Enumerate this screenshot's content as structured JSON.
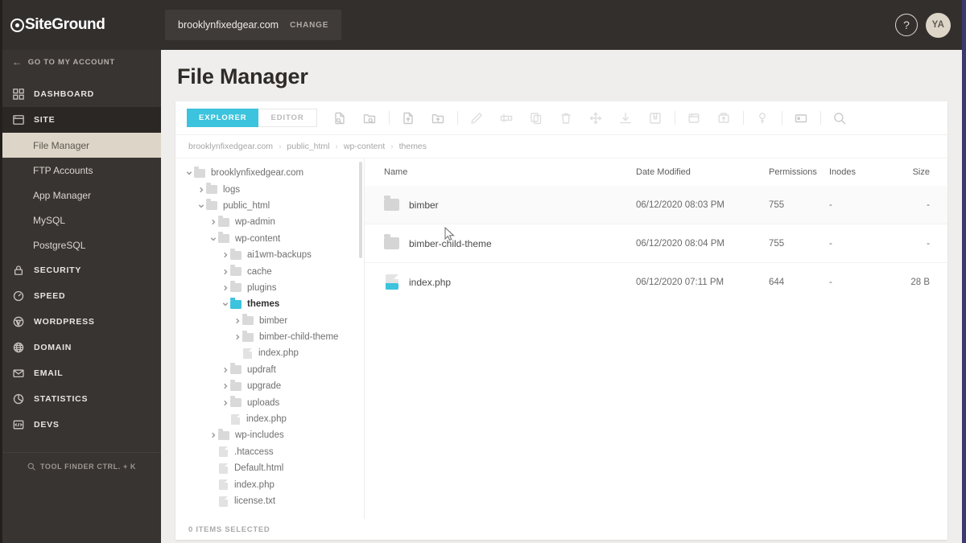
{
  "brand": {
    "name": "SiteGround",
    "mark_icon": "siteground-logo-icon"
  },
  "topbar": {
    "site_name": "brooklynfixedgear.com",
    "change_label": "CHANGE",
    "help_icon": "question-mark-icon",
    "help_label": "?",
    "avatar_initials": "YA"
  },
  "sidebar": {
    "go_back_label": "GO TO MY ACCOUNT",
    "go_back_icon": "arrow-left-icon",
    "items": [
      {
        "label": "DASHBOARD",
        "icon": "dashboard-grid-icon",
        "active": false
      },
      {
        "label": "SITE",
        "icon": "site-window-icon",
        "active": true
      },
      {
        "label": "SECURITY",
        "icon": "lock-icon",
        "active": false
      },
      {
        "label": "SPEED",
        "icon": "speed-gauge-icon",
        "active": false
      },
      {
        "label": "WORDPRESS",
        "icon": "wordpress-icon",
        "active": false
      },
      {
        "label": "DOMAIN",
        "icon": "globe-icon",
        "active": false
      },
      {
        "label": "EMAIL",
        "icon": "envelope-icon",
        "active": false
      },
      {
        "label": "STATISTICS",
        "icon": "pie-chart-icon",
        "active": false
      },
      {
        "label": "DEVS",
        "icon": "devs-shield-icon",
        "active": false
      }
    ],
    "sub_items": [
      {
        "label": "File Manager",
        "selected": true
      },
      {
        "label": "FTP Accounts",
        "selected": false
      },
      {
        "label": "App Manager",
        "selected": false
      },
      {
        "label": "MySQL",
        "selected": false
      },
      {
        "label": "PostgreSQL",
        "selected": false
      }
    ],
    "tool_finder": {
      "label": "TOOL FINDER CTRL. + K",
      "icon": "search-icon"
    }
  },
  "page": {
    "title": "File Manager"
  },
  "toolbar": {
    "tabs": [
      {
        "label": "EXPLORER",
        "active": true
      },
      {
        "label": "EDITOR",
        "active": false
      }
    ],
    "buttons": [
      {
        "name": "new-file-search-icon",
        "icon": "file-search-icon",
        "enabled": true
      },
      {
        "name": "new-folder-search-icon",
        "icon": "folder-search-icon",
        "enabled": true
      },
      {
        "name": "separator-1",
        "icon": "separator",
        "enabled": false
      },
      {
        "name": "upload-file-icon",
        "icon": "file-upload-icon",
        "enabled": true
      },
      {
        "name": "upload-folder-icon",
        "icon": "folder-upload-icon",
        "enabled": true
      },
      {
        "name": "separator-2",
        "icon": "separator",
        "enabled": false
      },
      {
        "name": "edit-icon",
        "icon": "pencil-icon",
        "enabled": false
      },
      {
        "name": "rename-icon",
        "icon": "rename-icon",
        "enabled": false
      },
      {
        "name": "copy-icon",
        "icon": "copy-icon",
        "enabled": false
      },
      {
        "name": "delete-icon",
        "icon": "trash-icon",
        "enabled": false
      },
      {
        "name": "move-icon",
        "icon": "move-arrows-icon",
        "enabled": false
      },
      {
        "name": "download-icon",
        "icon": "download-icon",
        "enabled": false
      },
      {
        "name": "archive-icon",
        "icon": "archive-icon",
        "enabled": false
      },
      {
        "name": "separator-3",
        "icon": "separator",
        "enabled": false
      },
      {
        "name": "compress-icon",
        "icon": "compress-icon",
        "enabled": false
      },
      {
        "name": "extract-icon",
        "icon": "extract-icon",
        "enabled": false
      },
      {
        "name": "separator-4",
        "icon": "separator",
        "enabled": false
      },
      {
        "name": "permissions-icon",
        "icon": "key-icon",
        "enabled": false
      },
      {
        "name": "separator-5",
        "icon": "separator",
        "enabled": false
      },
      {
        "name": "folder-options-icon",
        "icon": "folder-tag-icon",
        "enabled": true
      },
      {
        "name": "separator-6",
        "icon": "separator",
        "enabled": false
      },
      {
        "name": "search-icon",
        "icon": "search-icon",
        "enabled": true
      }
    ]
  },
  "breadcrumb": [
    "brooklynfixedgear.com",
    "public_html",
    "wp-content",
    "themes"
  ],
  "tree": [
    {
      "label": "brooklynfixedgear.com",
      "depth": 0,
      "type": "folder",
      "caret": "down",
      "highlight": false
    },
    {
      "label": "logs",
      "depth": 1,
      "type": "folder",
      "caret": "right",
      "highlight": false
    },
    {
      "label": "public_html",
      "depth": 1,
      "type": "folder",
      "caret": "down",
      "highlight": false
    },
    {
      "label": "wp-admin",
      "depth": 2,
      "type": "folder",
      "caret": "right",
      "highlight": false
    },
    {
      "label": "wp-content",
      "depth": 2,
      "type": "folder",
      "caret": "down",
      "highlight": false
    },
    {
      "label": "ai1wm-backups",
      "depth": 3,
      "type": "folder",
      "caret": "right",
      "highlight": false
    },
    {
      "label": "cache",
      "depth": 3,
      "type": "folder",
      "caret": "right",
      "highlight": false
    },
    {
      "label": "plugins",
      "depth": 3,
      "type": "folder",
      "caret": "right",
      "highlight": false
    },
    {
      "label": "themes",
      "depth": 3,
      "type": "folder",
      "caret": "down",
      "highlight": true
    },
    {
      "label": "bimber",
      "depth": 4,
      "type": "folder",
      "caret": "right",
      "highlight": false
    },
    {
      "label": "bimber-child-theme",
      "depth": 4,
      "type": "folder",
      "caret": "right",
      "highlight": false
    },
    {
      "label": "index.php",
      "depth": 4,
      "type": "file",
      "caret": "none",
      "highlight": false
    },
    {
      "label": "updraft",
      "depth": 3,
      "type": "folder",
      "caret": "right",
      "highlight": false
    },
    {
      "label": "upgrade",
      "depth": 3,
      "type": "folder",
      "caret": "right",
      "highlight": false
    },
    {
      "label": "uploads",
      "depth": 3,
      "type": "folder",
      "caret": "right",
      "highlight": false
    },
    {
      "label": "index.php",
      "depth": 3,
      "type": "file",
      "caret": "none",
      "highlight": false
    },
    {
      "label": "wp-includes",
      "depth": 2,
      "type": "folder",
      "caret": "right",
      "highlight": false
    },
    {
      "label": ".htaccess",
      "depth": 2,
      "type": "file",
      "caret": "none",
      "highlight": false
    },
    {
      "label": "Default.html",
      "depth": 2,
      "type": "file",
      "caret": "none",
      "highlight": false
    },
    {
      "label": "index.php",
      "depth": 2,
      "type": "file",
      "caret": "none",
      "highlight": false
    },
    {
      "label": "license.txt",
      "depth": 2,
      "type": "file",
      "caret": "none",
      "highlight": false
    }
  ],
  "file_list": {
    "columns": [
      "Name",
      "Date Modified",
      "Permissions",
      "Inodes",
      "Size"
    ],
    "rows": [
      {
        "name": "bimber",
        "type": "folder",
        "date": "06/12/2020 08:03 PM",
        "permissions": "755",
        "inodes": "-",
        "size": "-",
        "hover": true
      },
      {
        "name": "bimber-child-theme",
        "type": "folder",
        "date": "06/12/2020 08:04 PM",
        "permissions": "755",
        "inodes": "-",
        "size": "-",
        "hover": false
      },
      {
        "name": "index.php",
        "type": "php",
        "date": "06/12/2020 07:11 PM",
        "permissions": "644",
        "inodes": "-",
        "size": "28 B",
        "hover": false
      }
    ]
  },
  "status_bar": {
    "label": "0 ITEMS SELECTED"
  },
  "colors": {
    "accent_cyan": "#3cc3dd",
    "sidebar_bg": "#383431",
    "header_bg": "#332f2d",
    "selected_subitem_bg": "#ddd6c8",
    "right_border": "#3a3a6e"
  }
}
